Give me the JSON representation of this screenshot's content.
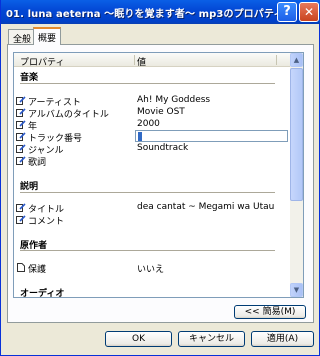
{
  "window": {
    "title": "01. luna aeterna ～眠りを覚ます者～ mp3のプロパティ"
  },
  "tabs": [
    {
      "label": "全般"
    },
    {
      "label": "概要"
    }
  ],
  "list": {
    "columns": {
      "property": "プロパティ",
      "value": "値"
    },
    "groups": {
      "music": "音楽",
      "description": "説明",
      "author": "原作者",
      "audio": "オーディオ"
    },
    "music_rows": [
      {
        "name": "アーティスト",
        "value": "Ah! My Goddess"
      },
      {
        "name": "アルバムのタイトル",
        "value": "Movie OST"
      },
      {
        "name": "年",
        "value": "2000"
      },
      {
        "name": "トラック番号",
        "value": ""
      },
      {
        "name": "ジャンル",
        "value": "Soundtrack"
      },
      {
        "name": "歌詞",
        "value": ""
      }
    ],
    "description_rows": [
      {
        "name": "タイトル",
        "value": "dea cantat ~ Megami wa Utau"
      },
      {
        "name": "コメント",
        "value": ""
      }
    ],
    "author_rows": [
      {
        "name": "保護",
        "value": "いいえ"
      }
    ]
  },
  "simple_button": "<< 簡易(M)",
  "buttons": {
    "ok": "OK",
    "cancel": "キャンセル",
    "apply": "適用(A)"
  }
}
